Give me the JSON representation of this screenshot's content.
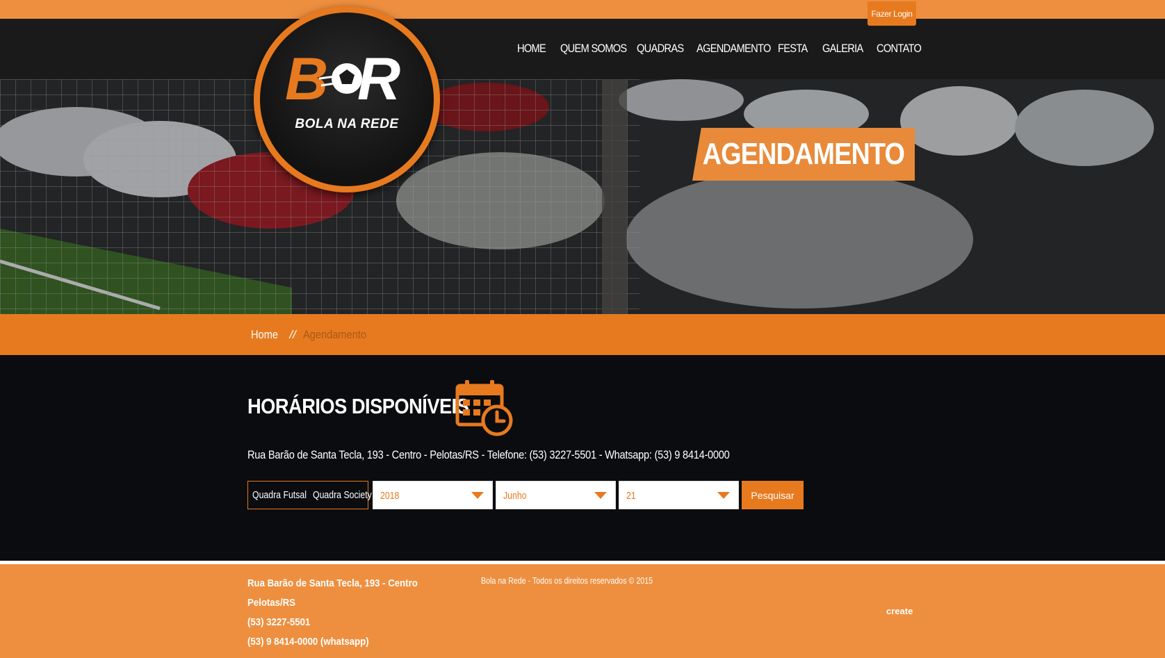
{
  "topbar": {
    "login_label": "Fazer Login"
  },
  "nav": {
    "items": [
      {
        "label": "HOME"
      },
      {
        "label": "QUEM SOMOS"
      },
      {
        "label": "QUADRAS"
      },
      {
        "label": "AGENDAMENTO"
      },
      {
        "label": "FESTA"
      },
      {
        "label": "GALERIA"
      },
      {
        "label": "CONTATO"
      }
    ]
  },
  "logo": {
    "text": "BOLA NA REDE",
    "letters": "BR"
  },
  "hero": {
    "title": "AGENDAMENTO"
  },
  "breadcrumb": {
    "home": "Home",
    "separator": "//",
    "current": "Agendamento"
  },
  "main": {
    "title": "HORÁRIOS DISPONÍVEIS",
    "address": "Rua Barão de Santa Tecla, 193 - Centro - Pelotas/RS - Telefone: (53) 3227-5501 - Whatsapp: (53) 9 8414-0000",
    "court_options": [
      "Quadra Futsal",
      "Quadra Society"
    ],
    "year": "2018",
    "month": "Junho",
    "day": "21",
    "search_label": "Pesquisar"
  },
  "footer": {
    "address_line1": "Rua Barão de Santa Tecla, 193 - Centro",
    "address_line2": "Pelotas/RS",
    "phone": "(53) 3227-5501",
    "whatsapp": "(53) 9 8414-0000 (whatsapp)",
    "copyright": "Bola na Rede - Todos os direitos reservados © 2015",
    "create": "create"
  },
  "colors": {
    "accent": "#e77a1f",
    "accent_light": "#ee8f3f",
    "dark": "#0b0c0f"
  }
}
